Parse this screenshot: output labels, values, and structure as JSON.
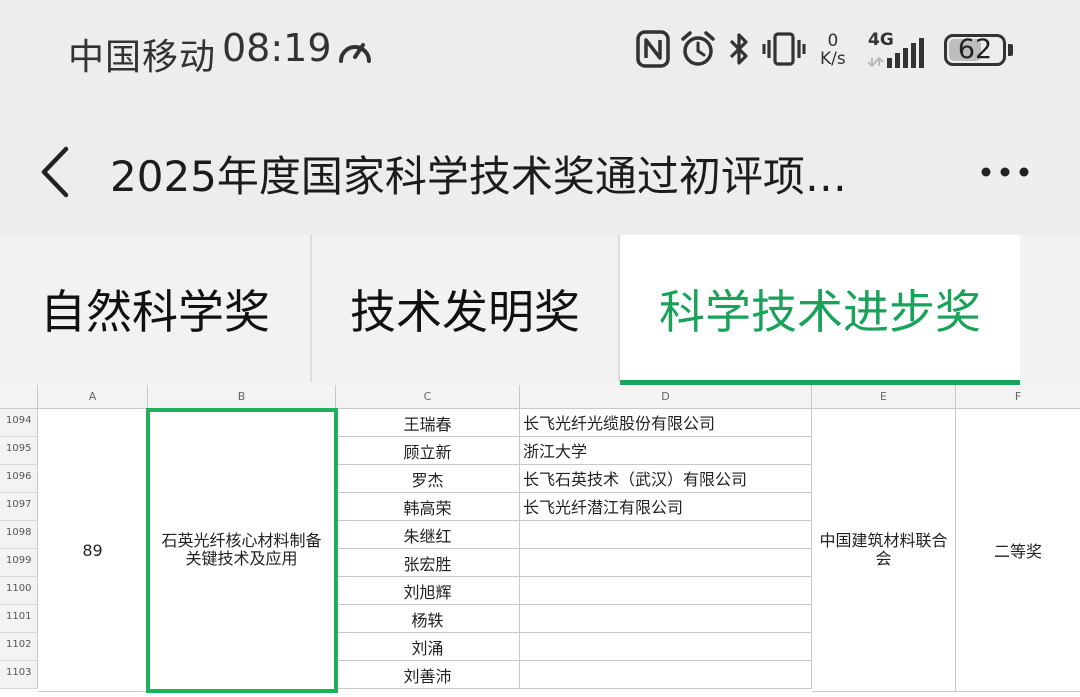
{
  "status": {
    "carrier": "中国移动",
    "time": "08:19",
    "net_speed_value": "0",
    "net_speed_unit": "K/s",
    "network": "4G",
    "battery": "62",
    "battery_level": 0.62,
    "icons": [
      "nfc-icon",
      "alarm-icon",
      "bluetooth-icon",
      "vibrate-icon",
      "signal-icon"
    ]
  },
  "appbar": {
    "title": "2025年度国家科学技术奖通过初评项…",
    "back_icon": "chevron-left-icon",
    "more_icon": "more-horizontal-icon"
  },
  "tabs": [
    {
      "label": "自然科学奖",
      "active": false
    },
    {
      "label": "技术发明奖",
      "active": false
    },
    {
      "label": "科学技术进步奖",
      "active": true
    }
  ],
  "accent_color": "#1aa35c",
  "sheet": {
    "columns": [
      "A",
      "B",
      "C",
      "D",
      "E",
      "F"
    ],
    "rows": [
      {
        "num": "1094",
        "c": "王瑞春",
        "d": "长飞光纤光缆股份有限公司"
      },
      {
        "num": "1095",
        "c": "顾立新",
        "d": "浙江大学"
      },
      {
        "num": "1096",
        "c": "罗杰",
        "d": "长飞石英技术（武汉）有限公司"
      },
      {
        "num": "1097",
        "c": "韩高荣",
        "d": "长飞光纤潜江有限公司"
      },
      {
        "num": "1098",
        "c": "朱继红",
        "d": ""
      },
      {
        "num": "1099",
        "c": "张宏胜",
        "d": ""
      },
      {
        "num": "1100",
        "c": "刘旭辉",
        "d": ""
      },
      {
        "num": "1101",
        "c": "杨轶",
        "d": ""
      },
      {
        "num": "1102",
        "c": "刘涌",
        "d": ""
      },
      {
        "num": "1103",
        "c": "刘善沛",
        "d": ""
      }
    ],
    "merged": {
      "a": "89",
      "b": "石英光纤核心材料制备关键技术及应用",
      "e": "中国建筑材料联合会",
      "f": "二等奖"
    }
  }
}
